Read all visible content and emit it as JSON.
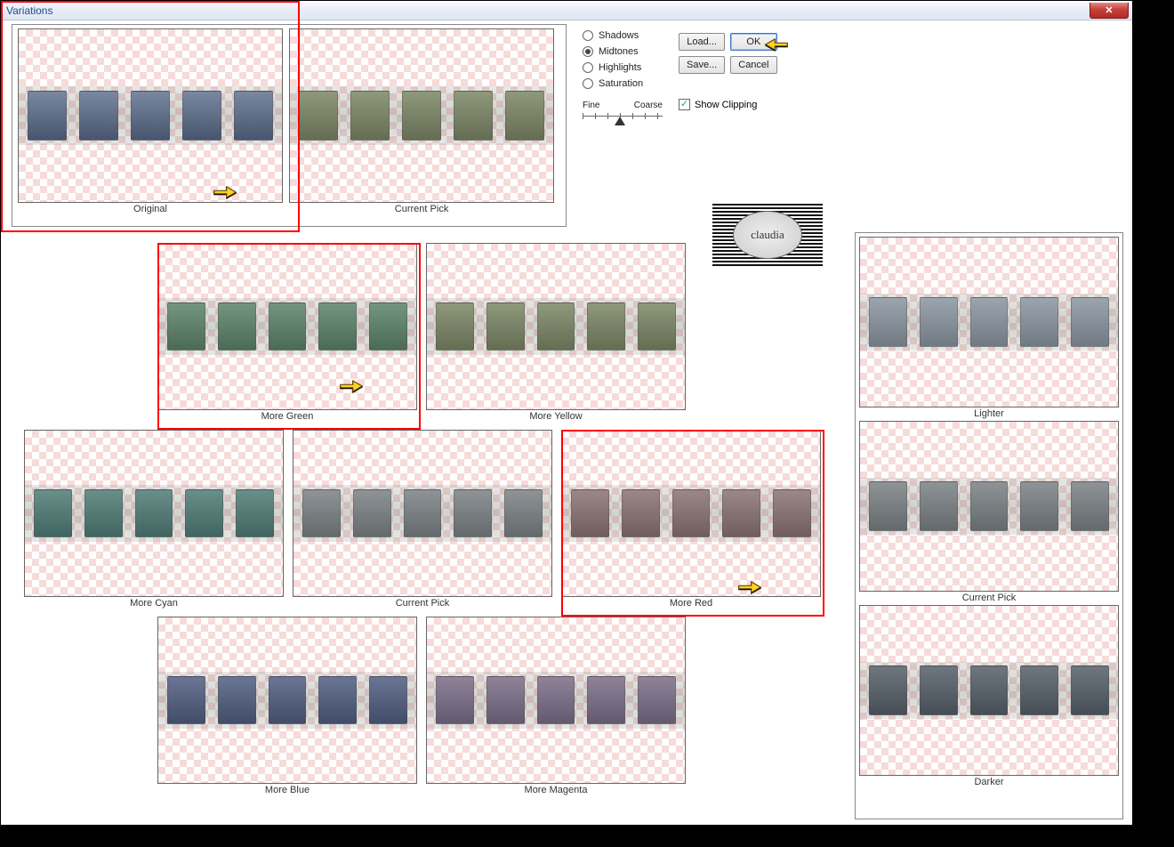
{
  "window": {
    "title": "Variations"
  },
  "top": {
    "original_label": "Original",
    "current_label": "Current Pick"
  },
  "radios": {
    "shadows": "Shadows",
    "midtones": "Midtones",
    "highlights": "Highlights",
    "saturation": "Saturation",
    "selected": "midtones"
  },
  "slider": {
    "left": "Fine",
    "right": "Coarse"
  },
  "buttons": {
    "load": "Load...",
    "ok": "OK",
    "save": "Save...",
    "cancel": "Cancel"
  },
  "checkbox": {
    "label": "Show Clipping",
    "checked": true
  },
  "grid": {
    "more_green": "More Green",
    "more_yellow": "More Yellow",
    "more_cyan": "More Cyan",
    "current_pick": "Current Pick",
    "more_red": "More Red",
    "more_blue": "More Blue",
    "more_magenta": "More Magenta"
  },
  "rightcol": {
    "lighter": "Lighter",
    "current_pick": "Current Pick",
    "darker": "Darker"
  },
  "watermark": "claudia"
}
